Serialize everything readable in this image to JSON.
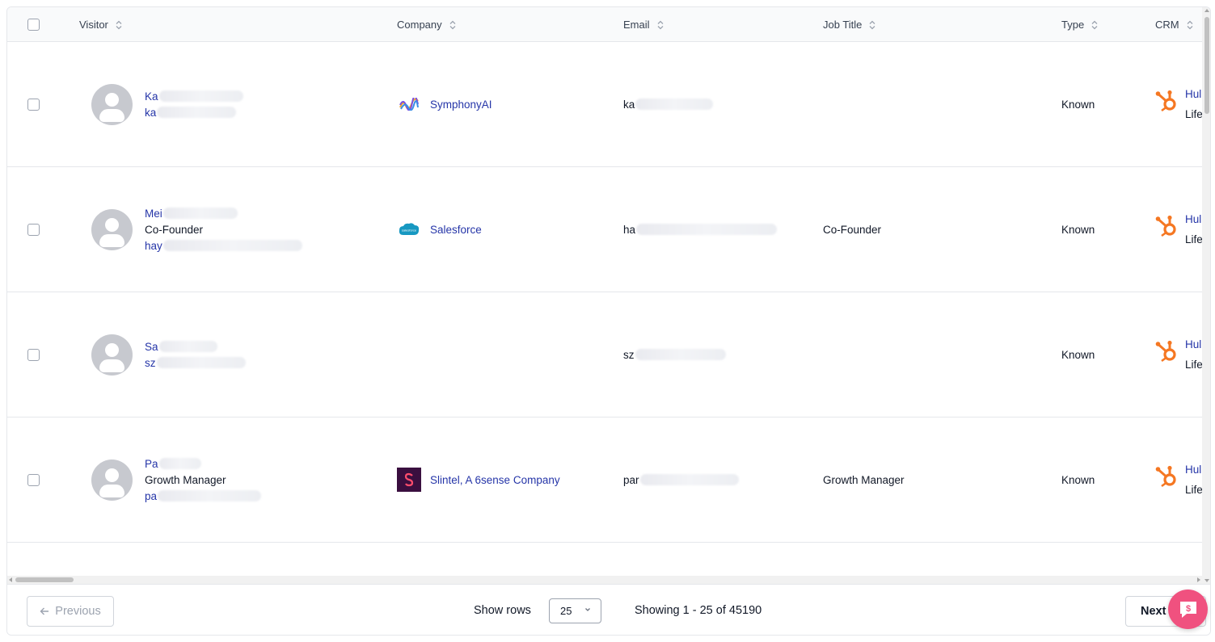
{
  "table": {
    "columns": [
      {
        "label": "Visitor"
      },
      {
        "label": "Company"
      },
      {
        "label": "Email"
      },
      {
        "label": "Job Title"
      },
      {
        "label": "Type"
      },
      {
        "label": "CRM"
      }
    ],
    "rows": [
      {
        "visitor": {
          "name": "Ka",
          "title": "",
          "email": "ka"
        },
        "company": {
          "name": "SymphonyAI",
          "logo": "symphonyai-logo"
        },
        "email": "ka",
        "job_title": "",
        "type": "Known",
        "crm": {
          "name": "Hul",
          "stage": "Life",
          "icon": "hubspot-icon"
        }
      },
      {
        "visitor": {
          "name": "Mei",
          "title": "Co-Founder",
          "email": "hay"
        },
        "company": {
          "name": "Salesforce",
          "logo": "salesforce-logo"
        },
        "email": "ha",
        "job_title": "Co-Founder",
        "type": "Known",
        "crm": {
          "name": "Hul",
          "stage": "Life",
          "icon": "hubspot-icon"
        }
      },
      {
        "visitor": {
          "name": "Sa",
          "title": "",
          "email": "sz"
        },
        "company": {
          "name": "",
          "logo": ""
        },
        "email": "sz",
        "job_title": "",
        "type": "Known",
        "crm": {
          "name": "Hul",
          "stage": "Life",
          "icon": "hubspot-icon"
        }
      },
      {
        "visitor": {
          "name": "Pa",
          "title": "Growth Manager",
          "email": "pa"
        },
        "company": {
          "name": "Slintel, A 6sense Company",
          "logo": "slintel-logo"
        },
        "email": "par",
        "job_title": "Growth Manager",
        "type": "Known",
        "crm": {
          "name": "Hul",
          "stage": "Life",
          "icon": "hubspot-icon"
        }
      }
    ]
  },
  "pagination": {
    "previous_label": "Previous",
    "next_label": "Next",
    "show_rows_label": "Show rows",
    "rows_per_page": "25",
    "showing_text": "Showing 1 - 25 of 45190"
  },
  "colors": {
    "link": "#2535a8",
    "hubspot": "#f57722",
    "chat": "#f0517f"
  }
}
